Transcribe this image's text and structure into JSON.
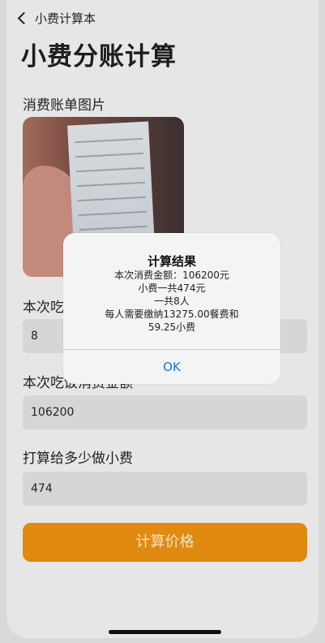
{
  "nav": {
    "back_label": "小费计算本"
  },
  "page": {
    "title": "小费分账计算"
  },
  "sections": {
    "receipt_label": "消费账单图片",
    "people_label": "本次吃饭人数",
    "amount_label": "本次吃饭消费金额",
    "tip_label": "打算给多少做小费"
  },
  "fields": {
    "people_value": "8",
    "amount_value": "106200",
    "tip_value": "474"
  },
  "buttons": {
    "calculate": "计算价格"
  },
  "alert": {
    "title": "计算结果",
    "line1": "本次消费金额：106200元",
    "line2": "小费一共474元",
    "line3": "一共8人",
    "line4": "每人需要缴纳13275.00餐费和",
    "line5": "59.25小费",
    "ok": "OK"
  },
  "colors": {
    "accent": "#e08a0f",
    "link": "#1a73e8"
  }
}
